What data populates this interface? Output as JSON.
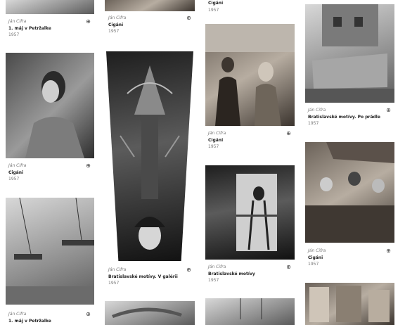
{
  "cards": [
    {
      "author": "Ján Cifra",
      "title": "1. máj v Petržalke",
      "year": "1957"
    },
    {
      "author": "",
      "title": "Cigáni",
      "year": "1957"
    },
    {
      "author": "",
      "title": "Cigáni",
      "year": "1957"
    },
    {
      "author": "Ján Cifra",
      "title": "Cigáni",
      "year": "1957"
    },
    {
      "author": "Ján Cifra",
      "title": "Bratislavské motívy. V galérii",
      "year": "1957"
    },
    {
      "author": "Ján Cifra",
      "title": "Bratislavské motívy",
      "year": "1957"
    },
    {
      "author": "Ján Cifra",
      "title": "Bratislavské motívy. Po prádle",
      "year": "1957"
    },
    {
      "author": "Ján Cifra",
      "title": "Cigáni",
      "year": "1957"
    },
    {
      "author": "Ján Cifra",
      "title": "Cigáni",
      "year": "1957"
    },
    {
      "author": "Ján Cifra",
      "title": "1. máj v Petržalke",
      "year": ""
    }
  ],
  "icons": {
    "zoom": "zoom-in-icon"
  }
}
